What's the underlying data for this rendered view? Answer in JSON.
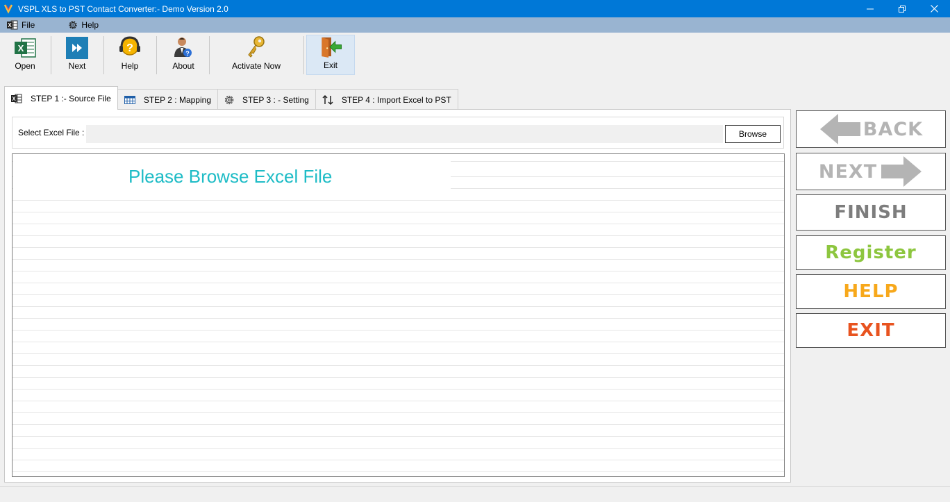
{
  "window": {
    "title": "VSPL XLS to PST Contact Converter:- Demo Version 2.0"
  },
  "menu": {
    "file": "File",
    "help": "Help"
  },
  "toolbar": {
    "open": "Open",
    "next": "Next",
    "help": "Help",
    "about": "About",
    "activate": "Activate Now",
    "exit": "Exit"
  },
  "tabs": [
    {
      "label": "STEP 1 :- Source File",
      "icon": "excel-icon",
      "selected": true
    },
    {
      "label": "STEP 2 : Mapping",
      "icon": "grid-icon",
      "selected": false
    },
    {
      "label": "STEP 3 : - Setting",
      "icon": "gear-icon",
      "selected": false
    },
    {
      "label": "STEP 4 : Import Excel to PST",
      "icon": "sort-arrows-icon",
      "selected": false
    }
  ],
  "source": {
    "label": "Select Excel File :",
    "value": "",
    "browse": "Browse",
    "placeholder_message": "Please Browse Excel File"
  },
  "side_buttons": {
    "back": "BACK",
    "next": "NEXT",
    "finish": "FINISH",
    "register": "Register",
    "help": "HELP",
    "exit": "EXIT"
  },
  "colors": {
    "titlebar": "#0078d7",
    "menubar": "#99b4d1",
    "placeholder_text": "#1ebcc6",
    "disabled_gray": "#b4b4b4",
    "finish_gray": "#7d7d7d",
    "register_green": "#8dc63f",
    "help_orange": "#f7a81b",
    "exit_red": "#e8531f"
  }
}
